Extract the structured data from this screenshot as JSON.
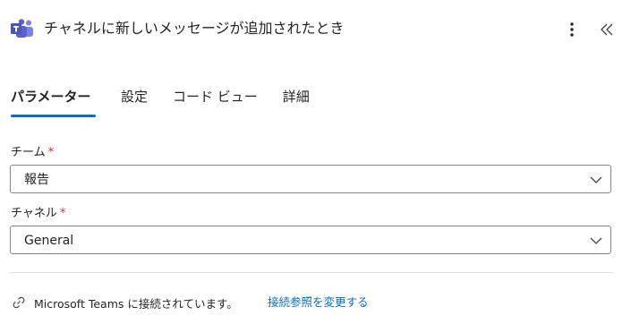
{
  "header": {
    "title": "チャネルに新しいメッセージが追加されたとき",
    "logo_icon": "microsoft-teams-logo-icon",
    "more_icon": "more-vertical-icon",
    "collapse_icon": "double-chevron-left-icon"
  },
  "tabs": [
    {
      "label": "パラメーター",
      "active": true
    },
    {
      "label": "設定",
      "active": false
    },
    {
      "label": "コード ビュー",
      "active": false
    },
    {
      "label": "詳細",
      "active": false
    }
  ],
  "fields": {
    "team": {
      "label": "チーム",
      "required_mark": "*",
      "value": "報告"
    },
    "channel": {
      "label": "チャネル",
      "required_mark": "*",
      "value": "General"
    }
  },
  "connection": {
    "icon": "link-icon",
    "text": "Microsoft Teams に接続されています。",
    "change_link": "接続参照を変更する"
  },
  "colors": {
    "accent": "#0f6cbd",
    "required": "#c4314b",
    "teams_purple": "#5b5fc7",
    "border": "#8a8886",
    "divider": "#e1dfdd"
  }
}
